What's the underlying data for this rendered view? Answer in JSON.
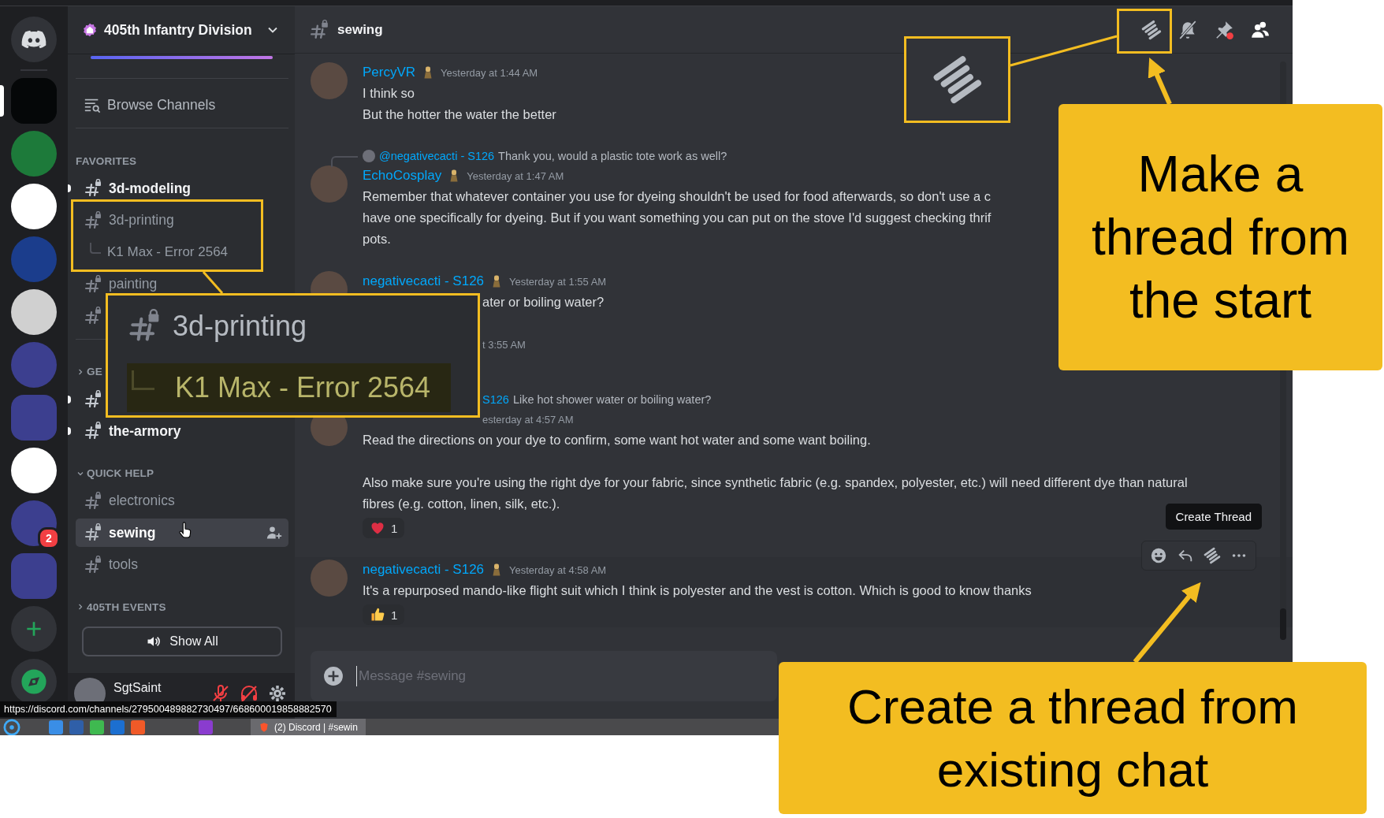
{
  "server_rail": [
    {
      "kind": "home",
      "selected": false
    },
    {
      "kind": "server",
      "selected": true
    },
    {
      "kind": "server",
      "selected": false
    },
    {
      "kind": "server",
      "selected": false
    },
    {
      "kind": "server",
      "selected": false
    },
    {
      "kind": "server",
      "selected": false
    },
    {
      "kind": "server",
      "selected": false
    },
    {
      "kind": "folder",
      "selected": false
    },
    {
      "kind": "server",
      "selected": false
    },
    {
      "kind": "server",
      "selected": false,
      "badge": "2"
    },
    {
      "kind": "folder",
      "selected": false
    },
    {
      "kind": "add",
      "selected": false
    },
    {
      "kind": "discover",
      "selected": false
    }
  ],
  "sidebar": {
    "server_name": "405th Infantry Division",
    "boost_bar": {
      "level": 1
    },
    "browse": "Browse Channels",
    "sections": [
      {
        "title": "FAVORITES",
        "channels": [
          {
            "name": "3d-modeling",
            "unread": true,
            "selected": false,
            "hovered": false
          },
          {
            "name": "3d-printing",
            "unread": false,
            "selected": false,
            "hovered": false,
            "children": [
              {
                "name": "K1 Max - Error 2564",
                "selected": false
              }
            ]
          },
          {
            "name": "painting",
            "unread": false,
            "selected": false,
            "hovered": false
          },
          {
            "unread": false,
            "selected": false,
            "hovered": false
          }
        ]
      },
      {
        "title": "GE",
        "expanded": false,
        "channels": [
          {
            "unread": true,
            "selected": false,
            "hovered": false
          },
          {
            "name": "the-armory",
            "unread": true,
            "selected": false,
            "hovered": false
          }
        ]
      },
      {
        "title": "QUICK HELP",
        "expanded": true,
        "channels": [
          {
            "name": "electronics",
            "unread": false,
            "selected": false,
            "hovered": false
          },
          {
            "name": "sewing",
            "unread": false,
            "selected": true,
            "hovered": true
          },
          {
            "name": "tools",
            "unread": false,
            "selected": false,
            "hovered": false
          }
        ]
      },
      {
        "title": "405TH EVENTS",
        "expanded": false
      }
    ],
    "show_all": "Show All",
    "user": {
      "name": "SgtSaint",
      "mic_muted": true,
      "deafened": true
    }
  },
  "chat": {
    "channel": "sewing",
    "pins_unread": true,
    "messages": [
      {
        "author": "PercyVR",
        "timestamp": "Yesterday at 1:44 AM",
        "lines": [
          "I think so",
          "But the hotter the water the better"
        ],
        "kind": "full",
        "hovered": false
      },
      {
        "reply": {
          "mention": "@negativecacti - S126",
          "text": "Thank you, would a plastic tote work as well?"
        },
        "author": "EchoCosplay",
        "timestamp": "Yesterday at 1:47 AM",
        "lines": [
          "Remember that whatever container you use for dyeing shouldn't be used for food afterwards, so don't use a c",
          "have one specifically for dyeing. But if you want something you can put on the stove I'd suggest checking thrif",
          "pots."
        ],
        "kind": "full",
        "hovered": false
      },
      {
        "author": "negativecacti - S126",
        "timestamp": "Yesterday at 1:55 AM",
        "lines": [
          "ater or boiling water?"
        ],
        "kind": "covered-text",
        "hovered": false
      },
      {
        "timestamp": "t 3:55 AM",
        "kind": "covered-head",
        "hovered": false
      },
      {
        "reply": {
          "mention": "S126",
          "text": "Like hot shower water or boiling water?"
        },
        "timestamp": "esterday at 4:57 AM",
        "lines": [
          "Read the directions on your dye to confirm, some want hot water and some want boiling.",
          "Also make sure you're using the right dye for your fabric, since synthetic fabric (e.g. spandex, polyester, etc.) will need different dye than natural fibres (e.g. cotton, linen, silk, etc.)."
        ],
        "blank_line_between": true,
        "kind": "covered-reply",
        "reactions": [
          {
            "kind": "heart",
            "count": "1"
          }
        ],
        "hovered": false
      },
      {
        "author": "negativecacti - S126",
        "timestamp": "Yesterday at 4:58 AM",
        "lines": [
          "It's a repurposed mando-like flight suit which I think is polyester and the vest is cotton. Which is good to know thanks"
        ],
        "kind": "full",
        "reactions": [
          {
            "kind": "thumbs-up",
            "count": "1"
          }
        ],
        "hovered": true,
        "tooltip": "Create Thread"
      }
    ],
    "composer": {
      "placeholder": "Message #sewing"
    }
  },
  "link_preview": "https://discord.com/channels/279500489882730497/668600019858882570",
  "taskbar": {
    "window_title": "(2) Discord | #sewin"
  },
  "annotations": {
    "sidebar_zoom": {
      "channel": "3d-printing",
      "thread": "K1 Max - Error 2564"
    },
    "callouts": [
      {
        "lines": [
          "Make a",
          "thread from",
          "the start"
        ]
      },
      {
        "lines": [
          "Create a thread from",
          "existing chat"
        ]
      }
    ]
  }
}
